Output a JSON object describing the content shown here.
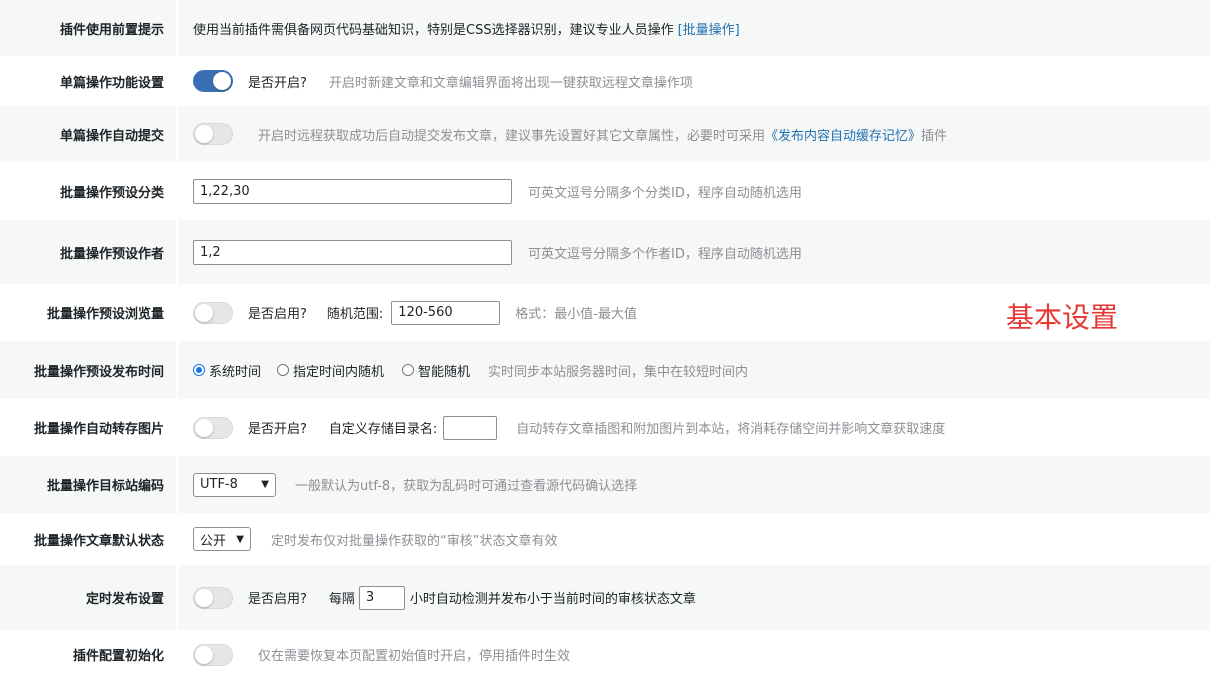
{
  "rows": {
    "r1": {
      "label": "插件使用前置提示",
      "text": "使用当前插件需俱备网页代码基础知识，特别是CSS选择器识别，建议专业人员操作",
      "link": "[批量操作]"
    },
    "r2": {
      "label": "单篇操作功能设置",
      "toggle_on": true,
      "question": "是否开启?",
      "hint": "开启时新建文章和文章编辑界面将出现一键获取远程文章操作项"
    },
    "r3": {
      "label": "单篇操作自动提交",
      "toggle_on": false,
      "hint_pre": "开启时远程获取成功后自动提交发布文章，建议事先设置好其它文章属性，必要时可采用",
      "link": "《发布内容自动缓存记忆》",
      "hint_post": "插件"
    },
    "r4": {
      "label": "批量操作预设分类",
      "value": "1,22,30",
      "hint": "可英文逗号分隔多个分类ID，程序自动随机选用"
    },
    "r5": {
      "label": "批量操作预设作者",
      "value": "1,2",
      "hint": "可英文逗号分隔多个作者ID，程序自动随机选用"
    },
    "r6": {
      "label": "批量操作预设浏览量",
      "toggle_on": false,
      "question": "是否启用?",
      "range_label": "随机范围:",
      "range_value": "120-560",
      "hint": "格式：最小值-最大值"
    },
    "r7": {
      "label": "批量操作预设发布时间",
      "options": [
        "系统时间",
        "指定时间内随机",
        "智能随机"
      ],
      "selected": "系统时间",
      "hint": "实时同步本站服务器时间，集中在较短时间内"
    },
    "r8": {
      "label": "批量操作自动转存图片",
      "toggle_on": false,
      "question": "是否开启?",
      "dir_label": "自定义存储目录名:",
      "dir_value": "",
      "hint": "自动转存文章插图和附加图片到本站，将消耗存储空间并影响文章获取速度"
    },
    "r9": {
      "label": "批量操作目标站编码",
      "select_value": "UTF-8",
      "hint": "一般默认为utf-8，获取为乱码时可通过查看源代码确认选择"
    },
    "r10": {
      "label": "批量操作文章默认状态",
      "select_value": "公开",
      "hint": "定时发布仅对批量操作获取的“审核”状态文章有效"
    },
    "r11": {
      "label": "定时发布设置",
      "toggle_on": false,
      "question": "是否启用?",
      "every": "每隔",
      "hours_value": "3",
      "suffix": "小时自动检测并发布小于当前时间的审核状态文章"
    },
    "r12": {
      "label": "插件配置初始化",
      "toggle_on": false,
      "hint": "仅在需要恢复本页配置初始值时开启，停用插件时生效"
    }
  },
  "annotation": "基本设置",
  "colors": {
    "accent": "#3a6fb3",
    "link": "#2271b1",
    "annotation": "#e53935",
    "alt_row": "#f6f7f7"
  }
}
